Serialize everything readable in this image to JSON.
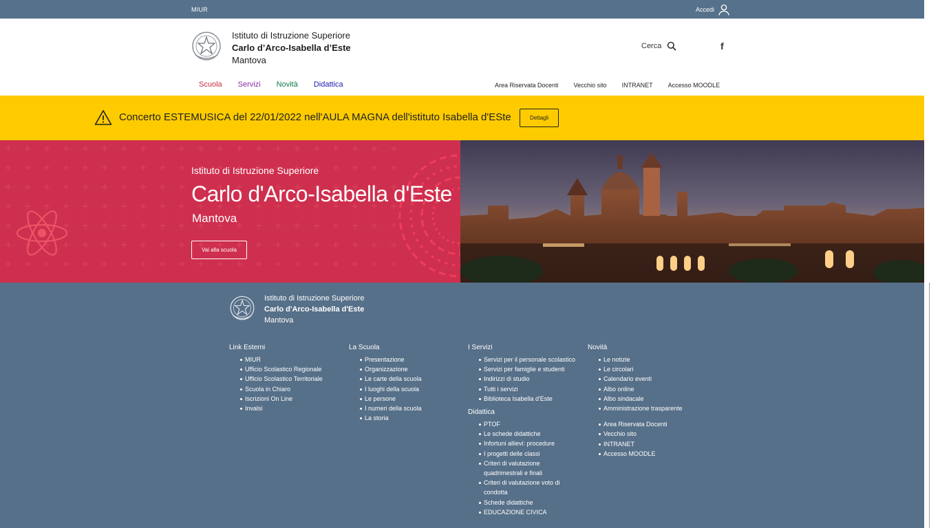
{
  "topbar": {
    "miur": "MIUR",
    "login_label": "Accedi"
  },
  "header": {
    "school_type": "Istituto di Istruzione Superiore",
    "school_name": "Carlo d’Arco-Isabella d’Este",
    "city": "Mantova",
    "search_label": "Cerca",
    "facebook_glyph": "f"
  },
  "main_nav": [
    {
      "label": "Scuola",
      "color": "#c92b3f"
    },
    {
      "label": "Servizi",
      "color": "#8a2aa6"
    },
    {
      "label": "Novità",
      "color": "#0f7a46"
    },
    {
      "label": "Didattica",
      "color": "#1a1ab0"
    }
  ],
  "secondary_nav": [
    "Area Riservata Docenti",
    "Vecchio sito",
    "INTRANET",
    "Accesso MOODLE"
  ],
  "alert": {
    "message": "Concerto ESTEMUSICA del 22/01/2022 nell'AULA MAGNA dell'istituto Isabella d'ESte",
    "button": "Dettagli",
    "color": "#fecb00"
  },
  "hero": {
    "kicker": "Istituto di Istruzione Superiore",
    "title": "Carlo d'Arco-Isabella d'Este",
    "subtitle": "Mantova",
    "button": "Vai alla scuola",
    "color": "#cf2f4e"
  },
  "footer": {
    "school_type": "Istituto di Istruzione Superiore",
    "school_name": "Carlo d'Arco-Isabella d'Este",
    "city": "Mantova",
    "columns": {
      "links": {
        "title": "Link Esterni",
        "items": [
          "MIUR",
          "Ufficio Scolastico Regionale",
          "Ufficio Scolastico Territoriale",
          "Scuola in Chiaro",
          "Iscrizioni On Line",
          "Invalsi"
        ]
      },
      "school": {
        "title": "La Scuola",
        "items": [
          "Presentazione",
          "Organizzazione",
          "Le carte della scuola",
          "I luoghi della scuola",
          "Le persone",
          "I numeri della scuola",
          "La storia"
        ]
      },
      "services": {
        "title": "I Servizi",
        "items": [
          "Servizi per il personale scolastico",
          "Servizi per famiglie e studenti",
          "Indirizzi di studio",
          "Tutti i servizi",
          "Biblioteca Isabella d'Este"
        ]
      },
      "didattica": {
        "title": "Didattica",
        "items": [
          "PTOF",
          "Le schede didattiche",
          "Infortuni allievi: procedure",
          "I progetti delle classi",
          "Criteri di valutazione quadrimestrali e finali",
          "Criteri di valutazione voto di condotta",
          "Schede didattiche",
          "EDUCAZIONE CIVICA"
        ]
      },
      "news": {
        "title": "Novità",
        "items": [
          "Le notizie",
          "Le circolari",
          "Calendario eventi",
          "Albo online",
          "Albo sindacale",
          "Amministrazione trasparente"
        ],
        "extra_items": [
          "Area Riservata Docenti",
          "Vecchio sito",
          "INTRANET",
          "Accesso MOODLE"
        ]
      }
    }
  }
}
